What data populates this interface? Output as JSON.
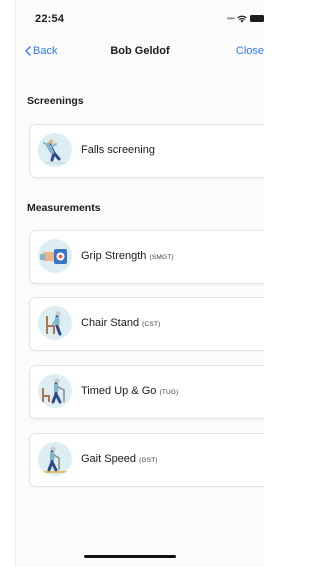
{
  "status_bar": {
    "time": "22:54"
  },
  "nav": {
    "back_label": "Back",
    "title": "Bob Geldof",
    "close_label": "Close"
  },
  "screenings": {
    "heading": "Screenings",
    "items": [
      {
        "label": "Falls screening",
        "icon": "falling-person-icon"
      }
    ]
  },
  "measurements": {
    "heading": "Measurements",
    "items": [
      {
        "label": "Grip Strength",
        "abbr": "(SMGT)",
        "icon": "grip-dynamometer-icon"
      },
      {
        "label": "Chair Stand",
        "abbr": "(CST)",
        "icon": "chair-stand-icon"
      },
      {
        "label": "Timed Up & Go",
        "abbr": "(TUG)",
        "icon": "timed-up-and-go-icon"
      },
      {
        "label": "Gait Speed",
        "abbr": "(GST)",
        "icon": "gait-speed-icon"
      }
    ]
  }
}
